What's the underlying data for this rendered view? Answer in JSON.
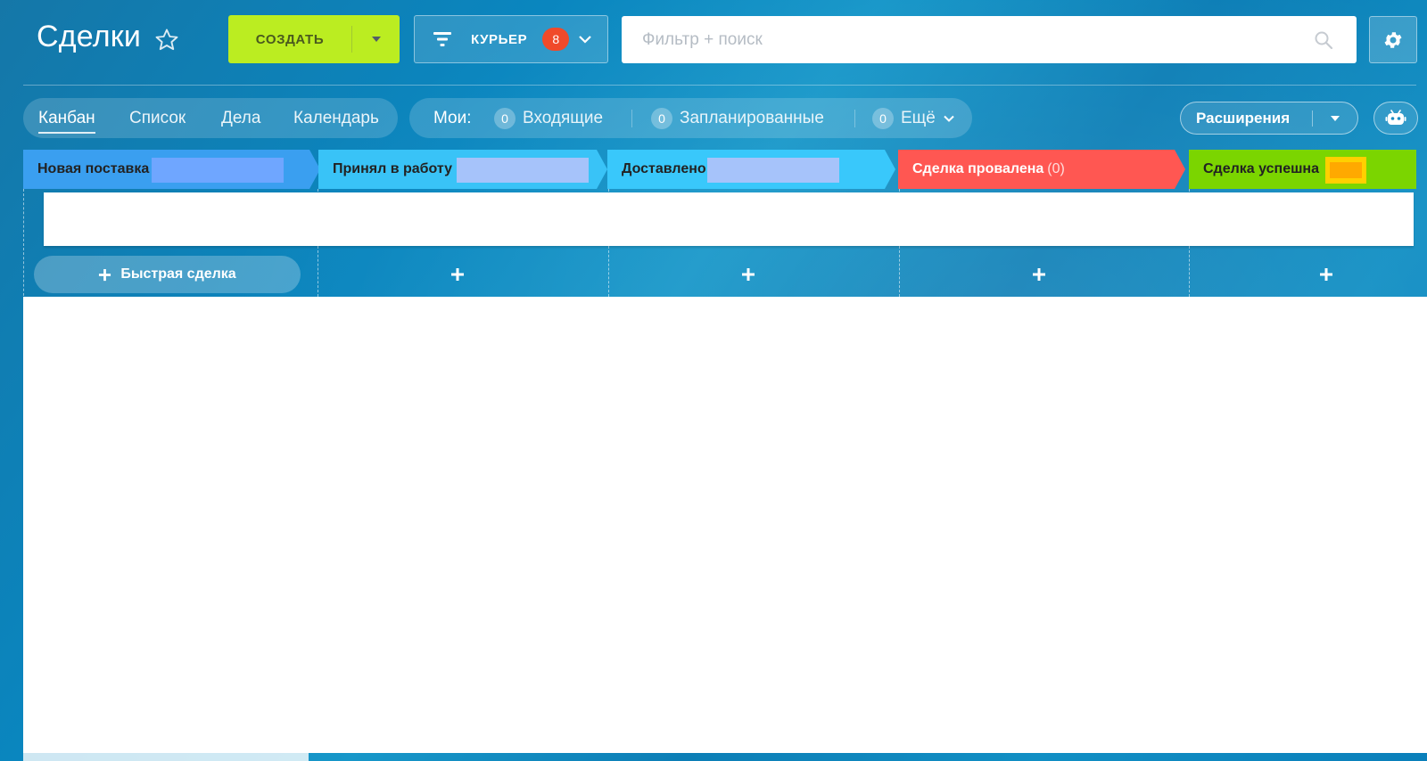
{
  "header": {
    "title": "Сделки",
    "create_label": "СОЗДАТЬ",
    "filter_label": "КУРЬЕР",
    "filter_badge": "8",
    "search_placeholder": "Фильтр + поиск"
  },
  "view_tabs": [
    "Канбан",
    "Список",
    "Дела",
    "Календарь"
  ],
  "active_view": "Канбан",
  "counters": {
    "label": "Мои:",
    "items": [
      {
        "count": "0",
        "label": "Входящие"
      },
      {
        "count": "0",
        "label": "Запланированные"
      },
      {
        "count": "0",
        "label": "Ещё"
      }
    ]
  },
  "extensions_label": "Расширения",
  "stages": [
    {
      "title": "Новая поставка",
      "count": "",
      "color": "#3a9ff0"
    },
    {
      "title": "Принял в работу",
      "count": "",
      "color": "#39c3f7"
    },
    {
      "title": "Доставлено",
      "count": "",
      "color": "#39c8fb"
    },
    {
      "title": "Сделка провалена",
      "count": "(0)",
      "color": "#ff5752"
    },
    {
      "title": "Сделка успешна",
      "count": "",
      "color": "#7bd500"
    }
  ],
  "quick_deal_label": "Быстрая сделка",
  "colors": {
    "create_button": "#bbed21",
    "filter_badge": "#f04a2a",
    "redaction_blue": "#a6c3fa",
    "redaction_orange": "#ffa900"
  }
}
